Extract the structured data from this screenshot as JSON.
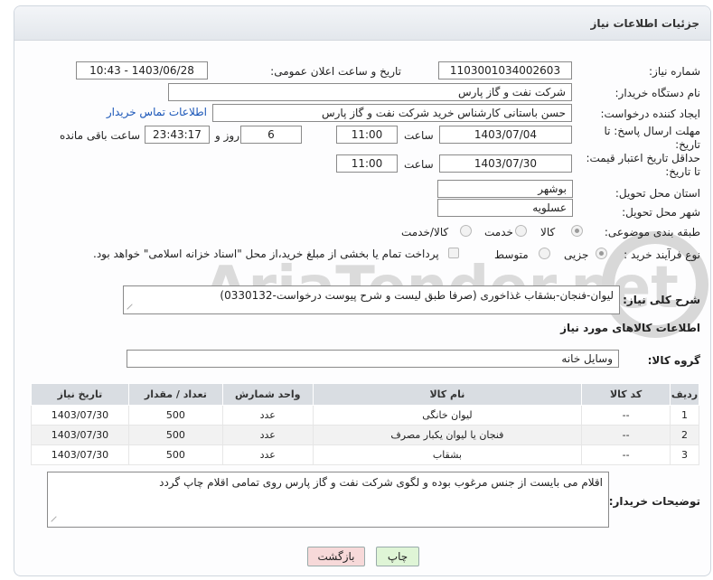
{
  "header": {
    "title": "جزئیات اطلاعات نیاز"
  },
  "form": {
    "need_number_label": "شماره نیاز:",
    "need_number": "1103001034002603",
    "announce_label": "تاریخ و ساعت اعلان عمومی:",
    "announce_value": "1403/06/28 - 10:43",
    "buyer_label": "نام دستگاه خریدار:",
    "buyer_value": "شرکت نفت و گاز پارس",
    "requester_label": "ایجاد کننده درخواست:",
    "requester_value": "حسن باستانی کارشناس خرید شرکت نفت و گاز پارس",
    "buyer_contact_link": "اطلاعات تماس خریدار",
    "deadline_label": "مهلت ارسال پاسخ: تا تاریخ:",
    "deadline_date": "1403/07/04",
    "time_label": "ساعت",
    "deadline_time": "11:00",
    "days_value": "6",
    "days_label": "روز و",
    "remaining_time": "23:43:17",
    "remaining_label": "ساعت باقی مانده",
    "validity_label": "حداقل تاریخ اعتبار قیمت: تا تاریخ:",
    "validity_date": "1403/07/30",
    "validity_time": "11:00",
    "province_label": "استان محل تحویل:",
    "province_value": "بوشهر",
    "city_label": "شهر محل تحویل:",
    "city_value": "عسلویه",
    "category_label": "طبقه بندی موضوعی:",
    "category_options": [
      "کالا",
      "خدمت",
      "کالا/خدمت"
    ],
    "process_label": "نوع فرآیند خرید :",
    "process_options": [
      "جزیی",
      "متوسط"
    ],
    "payment_note": "پرداخت تمام یا بخشی از مبلغ خرید،از محل \"اسناد خزانه اسلامی\" خواهد بود.",
    "description_label": "شرح کلی نیاز:",
    "description_value": "لیوان-فنجان-بشقاب غذاخوری (صرفا طبق لیست و شرح پیوست درخواست-0330132)",
    "goods_info_title": "اطلاعات کالاهای مورد نیاز",
    "goods_group_label": "گروه کالا:",
    "goods_group_value": "وسایل خانه"
  },
  "table": {
    "headers": [
      "ردیف",
      "کد کالا",
      "نام کالا",
      "واحد شمارش",
      "تعداد / مقدار",
      "تاریخ نیاز"
    ],
    "rows": [
      [
        "1",
        "--",
        "لیوان خانگی",
        "عدد",
        "500",
        "1403/07/30"
      ],
      [
        "2",
        "--",
        "فنجان یا لیوان یکبار مصرف",
        "عدد",
        "500",
        "1403/07/30"
      ],
      [
        "3",
        "--",
        "بشقاب",
        "عدد",
        "500",
        "1403/07/30"
      ]
    ]
  },
  "notes": {
    "label": "توضیحات خریدار:",
    "value": "اقلام می بایست از جنس مرغوب بوده و لگوی شرکت نفت و گاز پارس روی تمامی اقلام چاپ گردد"
  },
  "buttons": {
    "print": "چاپ",
    "back": "بازگشت"
  },
  "watermark": {
    "text": "AriaTender.net"
  },
  "colors": {
    "link": "#1a56b8",
    "back_button": "#f7d9d9",
    "print_button": "#dff5d6",
    "watermark": "#d8d8d8"
  }
}
